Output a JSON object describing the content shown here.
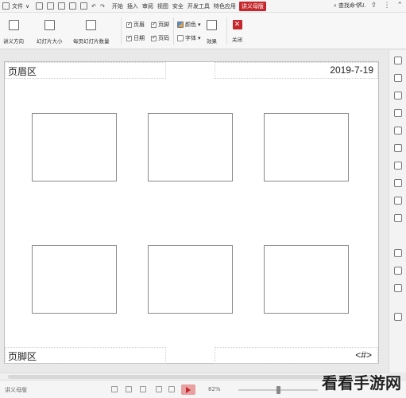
{
  "menu": {
    "file_label": "文件",
    "tabs": [
      "开始",
      "插入",
      "审阅",
      "视图",
      "安全",
      "开发工具",
      "特色应用"
    ],
    "active_tab": "讲义母版",
    "search_text": "查找命令..."
  },
  "ribbon": {
    "handout_orientation": "讲义方向",
    "slide_size": "幻灯片大小",
    "slides_per_page": "每页幻灯片数量",
    "chk_header": "页眉",
    "chk_footer": "页脚",
    "chk_date": "日期",
    "chk_page_number": "页码",
    "colors": "颜色",
    "fonts": "字体",
    "effects": "效果",
    "close": "关闭"
  },
  "page": {
    "header_text": "页眉区",
    "date_text": "2019-7-19",
    "footer_text": "页脚区",
    "page_number": "<#>"
  },
  "status": {
    "view_name": "讲义母版",
    "zoom": "82%"
  },
  "watermark": "看看手游网",
  "colors": {
    "accent": "#c4282d"
  }
}
